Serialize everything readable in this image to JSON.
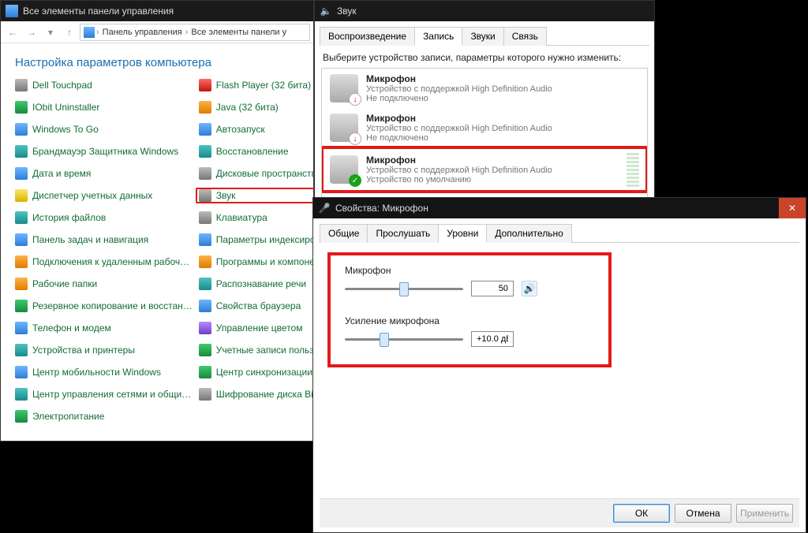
{
  "cp": {
    "title": "Все элементы панели управления",
    "breadcrumb": {
      "a": "Панель управления",
      "b": "Все элементы панели у"
    },
    "header": "Настройка параметров компьютера",
    "left": [
      {
        "label": "Dell Touchpad",
        "ic": "ic-gray"
      },
      {
        "label": "IObit Uninstaller",
        "ic": "ic-green"
      },
      {
        "label": "Windows To Go",
        "ic": "ic-blue"
      },
      {
        "label": "Брандмауэр Защитника Windows",
        "ic": "ic-teal"
      },
      {
        "label": "Дата и время",
        "ic": "ic-blue"
      },
      {
        "label": "Диспетчер учетных данных",
        "ic": "ic-yellow"
      },
      {
        "label": "История файлов",
        "ic": "ic-teal"
      },
      {
        "label": "Панель задач и навигация",
        "ic": "ic-blue"
      },
      {
        "label": "Подключения к удаленным рабоч…",
        "ic": "ic-orange"
      },
      {
        "label": "Рабочие папки",
        "ic": "ic-orange"
      },
      {
        "label": "Резервное копирование и восстан…",
        "ic": "ic-green"
      },
      {
        "label": "Телефон и модем",
        "ic": "ic-blue"
      },
      {
        "label": "Устройства и принтеры",
        "ic": "ic-teal"
      },
      {
        "label": "Центр мобильности Windows",
        "ic": "ic-blue"
      },
      {
        "label": "Центр управления сетями и общи…",
        "ic": "ic-teal"
      },
      {
        "label": "Электропитание",
        "ic": "ic-green"
      }
    ],
    "right": [
      {
        "label": "Flash Player (32 бита)",
        "ic": "ic-red"
      },
      {
        "label": "Java (32 бита)",
        "ic": "ic-orange"
      },
      {
        "label": "Автозапуск",
        "ic": "ic-blue"
      },
      {
        "label": "Восстановление",
        "ic": "ic-teal"
      },
      {
        "label": "Дисковые пространства",
        "ic": "ic-gray"
      },
      {
        "label": "Звук",
        "ic": "ic-gray",
        "hl": true
      },
      {
        "label": "Клавиатура",
        "ic": "ic-gray"
      },
      {
        "label": "Параметры индексиров",
        "ic": "ic-blue"
      },
      {
        "label": "Программы и компонен",
        "ic": "ic-orange"
      },
      {
        "label": "Распознавание речи",
        "ic": "ic-teal"
      },
      {
        "label": "Свойства браузера",
        "ic": "ic-blue"
      },
      {
        "label": "Управление цветом",
        "ic": "ic-purple"
      },
      {
        "label": "Учетные записи пользо",
        "ic": "ic-green"
      },
      {
        "label": "Центр синхронизации",
        "ic": "ic-green"
      },
      {
        "label": "Шифрование диска BitLo",
        "ic": "ic-gray"
      }
    ]
  },
  "snd": {
    "title": "Звук",
    "tabs": [
      "Воспроизведение",
      "Запись",
      "Звуки",
      "Связь"
    ],
    "active_tab": 1,
    "hint": "Выберите устройство записи, параметры которого нужно изменить:",
    "devices": [
      {
        "name": "Микрофон",
        "desc": "Устройство с поддержкой High Definition Audio",
        "status": "Не подключено",
        "badge": "red"
      },
      {
        "name": "Микрофон",
        "desc": "Устройство с поддержкой High Definition Audio",
        "status": "Не подключено",
        "badge": "red"
      },
      {
        "name": "Микрофон",
        "desc": "Устройство с поддержкой High Definition Audio",
        "status": "Устройство по умолчанию",
        "badge": "grn",
        "hl": true,
        "meter": true
      }
    ]
  },
  "prop": {
    "title": "Свойства: Микрофон",
    "tabs": [
      "Общие",
      "Прослушать",
      "Уровни",
      "Дополнительно"
    ],
    "active_tab": 2,
    "mic_label": "Микрофон",
    "mic_value": "50",
    "mic_percent": 50,
    "gain_label": "Усиление микрофона",
    "gain_value": "+10.0 дБ",
    "gain_percent": 33,
    "buttons": {
      "ok": "ОК",
      "cancel": "Отмена",
      "apply": "Применить"
    }
  }
}
